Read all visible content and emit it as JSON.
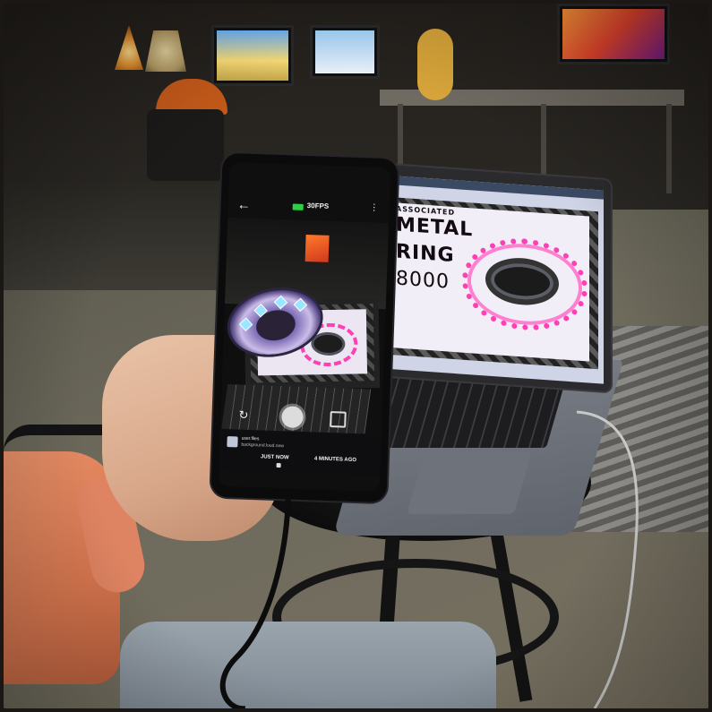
{
  "photo": {
    "laptop_screen": {
      "art_text_top": "ASSOCIATED",
      "art_text_line1": "METAL",
      "art_text_line2": "RING",
      "art_text_line3": "8000"
    },
    "phone_screen": {
      "back_icon": "back-arrow-icon",
      "fps_label": "30FPS",
      "menu_icon": "menu-icon",
      "notification": {
        "title": "user.files",
        "subtitle": "background.loud.now",
        "time_left": "JUST NOW",
        "time_right": "4 MINUTES AGO"
      }
    },
    "colors": {
      "sleeve": "#d9774f",
      "halo": "#ff3fb4",
      "fps_indicator": "#2fcf45"
    }
  }
}
